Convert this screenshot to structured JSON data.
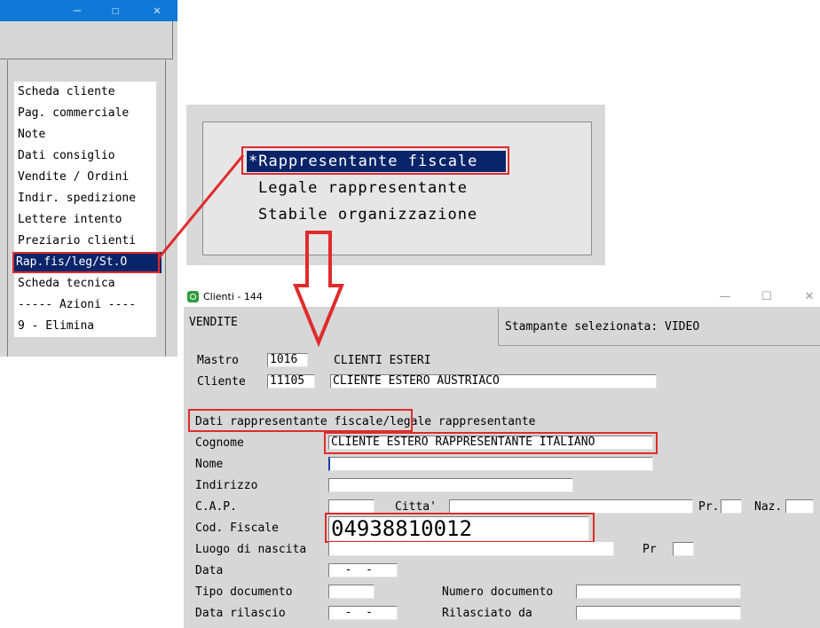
{
  "left_window": {
    "controls": [
      "—",
      "☐",
      "✕"
    ],
    "menu": [
      "Scheda cliente",
      "Pag. commerciale",
      "Note",
      "Dati consiglio",
      "Vendite / Ordini",
      "Indir. spedizione",
      "Lettere intento",
      "Preziario clienti",
      "Rap.fis/leg/St.O",
      "Scheda tecnica",
      "----- Azioni ----",
      "9 - Elimina"
    ]
  },
  "popup": {
    "items": [
      "*Rappresentante fiscale",
      "Legale rappresentante",
      "Stabile organizzazione"
    ]
  },
  "clienti_window": {
    "title": "Clienti - 144",
    "controls": [
      "—",
      "☐",
      "✕"
    ],
    "section": "VENDITE",
    "printer": "Stampante selezionata: VIDEO",
    "mastro_label": "Mastro",
    "mastro_code": "1016",
    "mastro_name": "CLIENTI ESTERI",
    "cliente_label": "Cliente",
    "cliente_code": "11105",
    "cliente_name": "CLIENTE ESTERO AUSTRIACO",
    "heading": "Dati rappresentante fiscale/legale rappresentante",
    "fields": {
      "cognome_label": "Cognome",
      "cognome_value": "CLIENTE ESTERO RAPPRESENTANTE ITALIANO",
      "nome_label": "Nome",
      "indirizzo_label": "Indirizzo",
      "cap_label": "C.A.P.",
      "citta_label": "Citta'",
      "pr_label": "Pr.",
      "naz_label": "Naz.",
      "codfisc_label": "Cod. Fiscale",
      "codfisc_value": "04938810012",
      "luogo_label": "Luogo di nascita",
      "pr2_label": "Pr",
      "data_label": "Data",
      "date_placeholder": "  -  -",
      "tipo_label": "Tipo documento",
      "numero_label": "Numero documento",
      "rilascio_label": "Data rilascio",
      "rilasciato_label": "Rilasciato da"
    }
  }
}
